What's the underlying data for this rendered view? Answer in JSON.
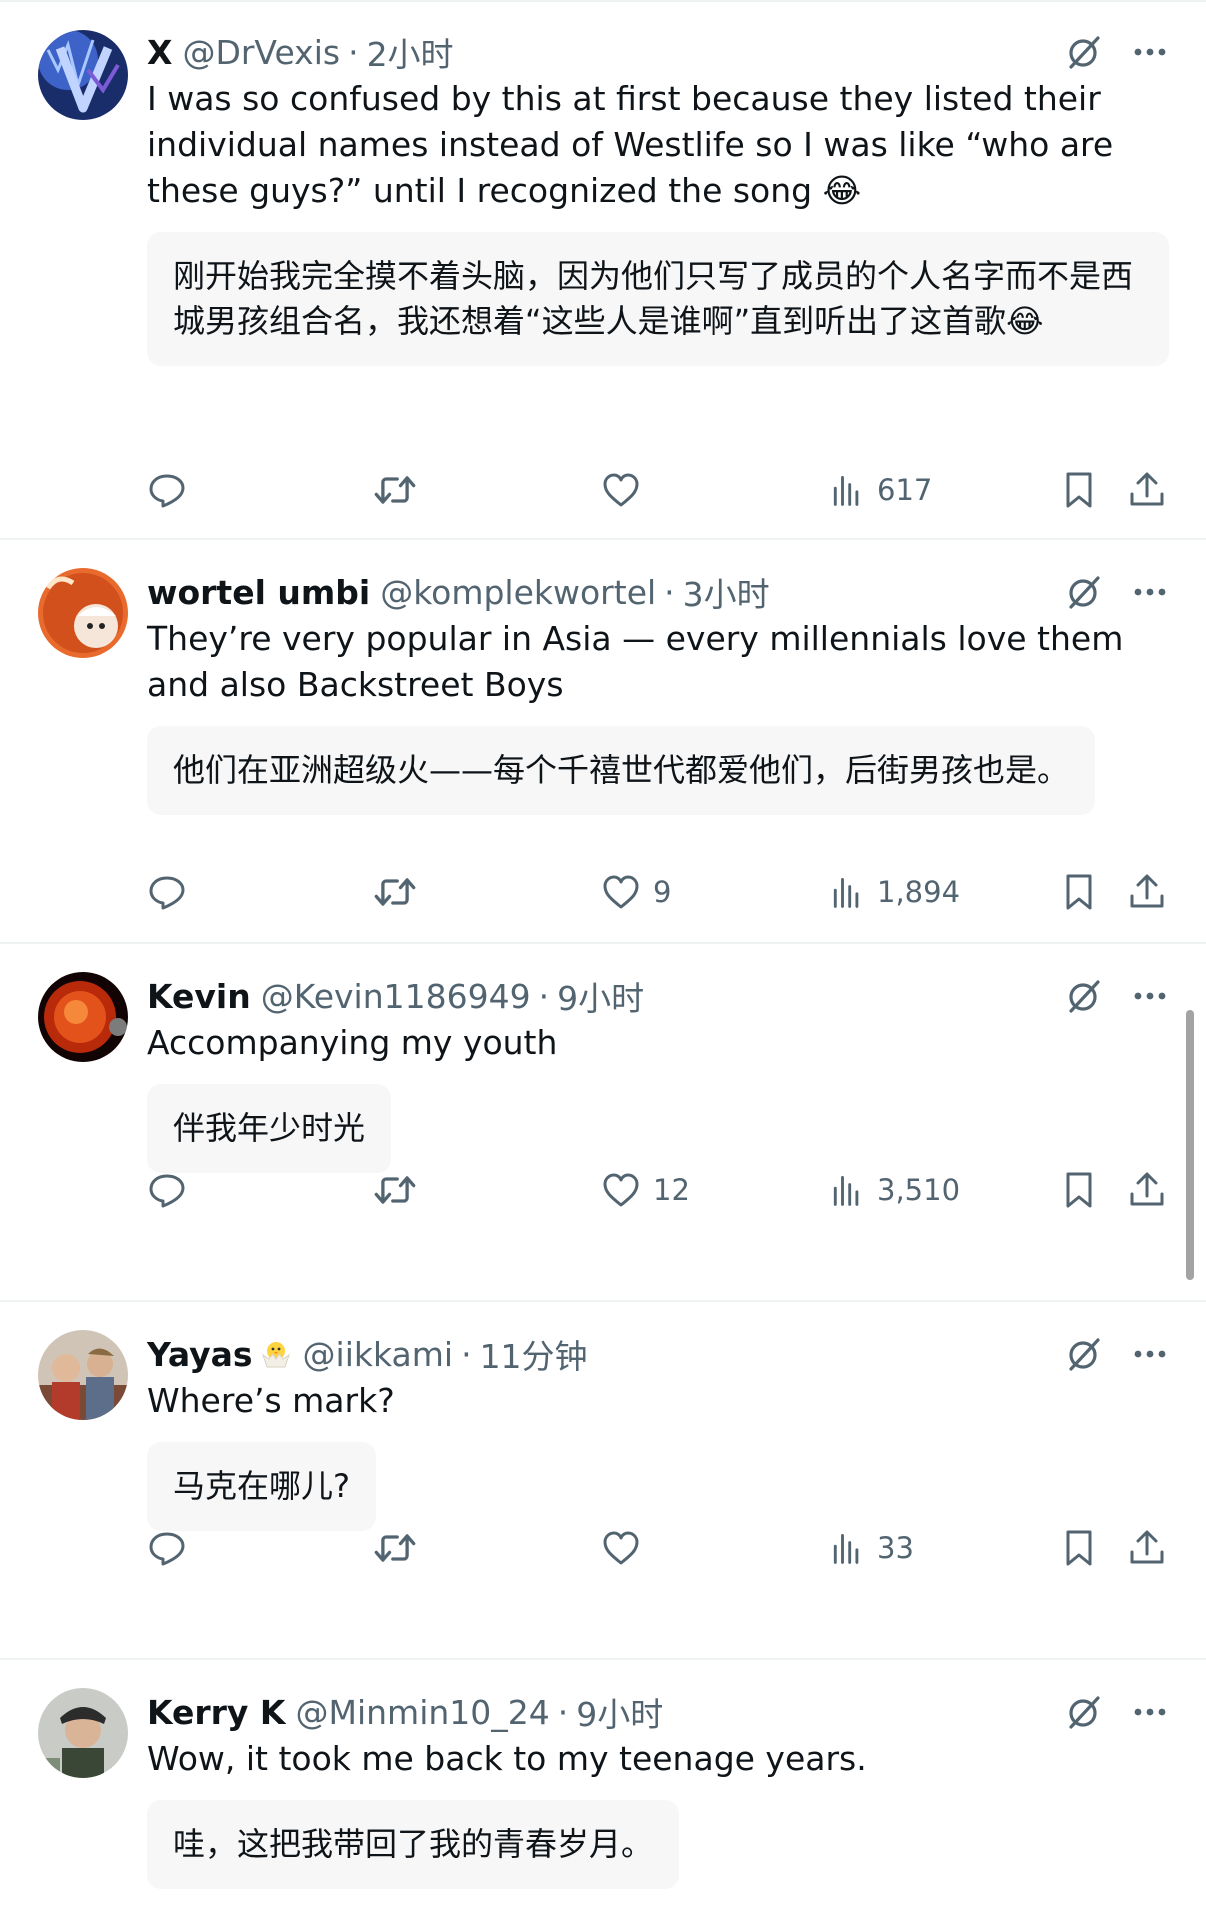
{
  "posts": [
    {
      "name": "X",
      "badge": "",
      "handle": "@DrVexis",
      "time": "2小时",
      "text": "I was so confused by this at first because they listed their individual names instead of Westlife so I was like “who are these guys?” until I recognized the song 😂",
      "translation": "刚开始我完全摸不着头脑，因为他们只写了成员的个人名字而不是西城男孩组合名，我还想着“这些人是谁啊”直到听出了这首歌😂",
      "likes": "",
      "views": "617"
    },
    {
      "name": "wortel umbi",
      "badge": "",
      "handle": "@komplekwortel",
      "time": "3小时",
      "text": "They’re very popular in Asia — every millennials love them and also Backstreet Boys",
      "translation": "他们在亚洲超级火——每个千禧世代都爱他们，后街男孩也是。",
      "likes": "9",
      "views": "1,894"
    },
    {
      "name": "Kevin",
      "badge": "",
      "handle": "@Kevin1186949",
      "time": "9小时",
      "text": "Accompanying my youth",
      "translation": "伴我年少时光",
      "likes": "12",
      "views": "3,510"
    },
    {
      "name": "Yayas",
      "badge": "🐣",
      "handle": "@iikkami",
      "time": "11分钟",
      "text": "Where’s mark?",
      "translation": "马克在哪儿?",
      "likes": "",
      "views": "33"
    },
    {
      "name": "Kerry K",
      "badge": "",
      "handle": "@Minmin10_24",
      "time": "9小时",
      "text": "Wow, it took me back to my teenage years.",
      "translation": "哇，这把我带回了我的青春岁月。",
      "likes": "",
      "views": ""
    }
  ],
  "colors": {
    "text": "#0f1419",
    "secondary": "#536471",
    "divider": "#eff3f4",
    "translation_bg": "#f7f7f7"
  },
  "icons": [
    "grok-icon",
    "more-icon",
    "reply-icon",
    "repost-icon",
    "like-icon",
    "views-icon",
    "bookmark-icon",
    "share-icon"
  ]
}
